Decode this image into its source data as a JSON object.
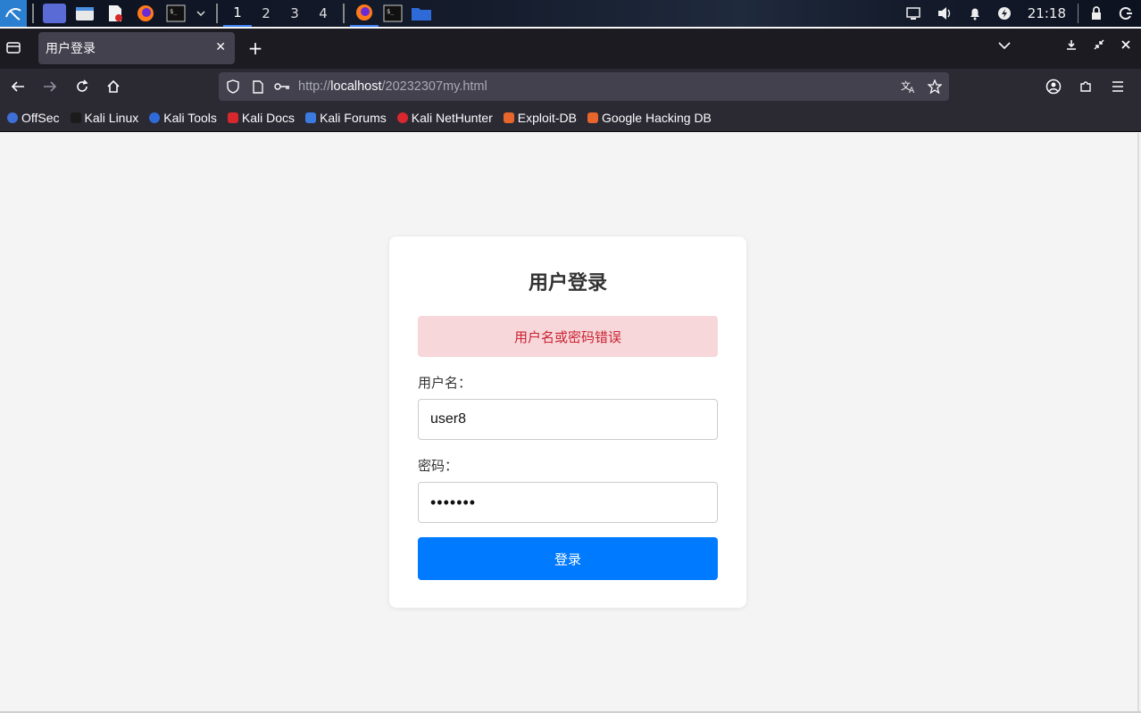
{
  "taskbar": {
    "workspaces": [
      "1",
      "2",
      "3",
      "4"
    ],
    "clock": "21:18"
  },
  "browser": {
    "tab_title": "用户登录",
    "url_scheme": "http://",
    "url_host": "localhost",
    "url_path": "/20232307my.html",
    "bookmarks": [
      {
        "label": "OffSec",
        "color": "#3d6fd6"
      },
      {
        "label": "Kali Linux",
        "color": "#1b1b1b"
      },
      {
        "label": "Kali Tools",
        "color": "#2f6bd8"
      },
      {
        "label": "Kali Docs",
        "color": "#d8282d"
      },
      {
        "label": "Kali Forums",
        "color": "#3b7be0"
      },
      {
        "label": "Kali NetHunter",
        "color": "#d8282d"
      },
      {
        "label": "Exploit-DB",
        "color": "#e8662c"
      },
      {
        "label": "Google Hacking DB",
        "color": "#e8662c"
      }
    ]
  },
  "login": {
    "title": "用户登录",
    "error": "用户名或密码错误",
    "username_label": "用户名：",
    "username_value": "user8",
    "password_label": "密码：",
    "password_value": "•••••••",
    "submit_label": "登录"
  },
  "colors": {
    "primary": "#007bff",
    "alert_bg": "#f8d7da",
    "alert_text": "#c82333"
  }
}
